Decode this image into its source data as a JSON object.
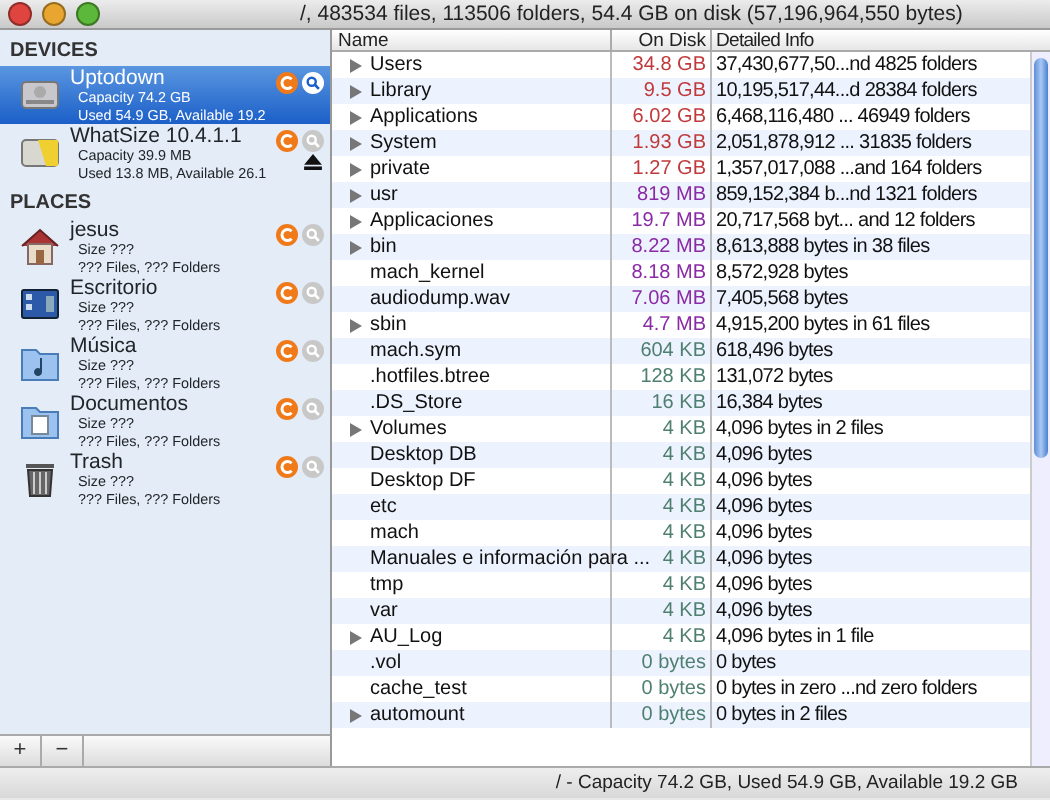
{
  "window": {
    "title": "/, 483534 files, 113506 folders, 54.4 GB on disk (57,196,964,550 bytes)"
  },
  "sidebar": {
    "sections": [
      {
        "heading": "DEVICES",
        "items": [
          {
            "kind": "drive",
            "title": "Uptodown",
            "line_1": "Capacity 74.2 GB",
            "line_2": "Used 54.9 GB, Available 19.2",
            "selected": true,
            "ejectable": false
          },
          {
            "kind": "usb-drive",
            "title": "WhatSize 10.4.1.1",
            "line_1": "Capacity 39.9 MB",
            "line_2": "Used 13.8 MB, Available 26.1",
            "selected": false,
            "ejectable": true
          }
        ]
      },
      {
        "heading": "PLACES",
        "items": [
          {
            "kind": "home",
            "title": "jesus",
            "line_1": "Size ???",
            "line_2": "??? Files, ??? Folders",
            "selected": false,
            "ejectable": false
          },
          {
            "kind": "desktop",
            "title": "Escritorio",
            "line_1": "Size ???",
            "line_2": "??? Files, ??? Folders",
            "selected": false,
            "ejectable": false
          },
          {
            "kind": "music",
            "title": "Música",
            "line_1": "Size ???",
            "line_2": "??? Files, ??? Folders",
            "selected": false,
            "ejectable": false
          },
          {
            "kind": "documents",
            "title": "Documentos",
            "line_1": "Size ???",
            "line_2": "??? Files, ??? Folders",
            "selected": false,
            "ejectable": false
          },
          {
            "kind": "trash",
            "title": "Trash",
            "line_1": "Size ???",
            "line_2": "??? Files, ??? Folders",
            "selected": false,
            "ejectable": false
          }
        ]
      }
    ],
    "buttons": [
      "+",
      "−"
    ]
  },
  "table": {
    "columns": [
      "Name",
      "On Disk",
      "Detailed Info"
    ],
    "rows": [
      {
        "name": "Users",
        "on_disk": "34.8 GB",
        "info": "37,430,677,50...nd 4825 folders",
        "expandable": true,
        "color": "#c0393b"
      },
      {
        "name": "Library",
        "on_disk": "9.5 GB",
        "info": "10,195,517,44...d 28384 folders",
        "expandable": true,
        "color": "#c0393b"
      },
      {
        "name": "Applications",
        "on_disk": "6.02 GB",
        "info": "6,468,116,480 ... 46949 folders",
        "expandable": true,
        "color": "#c0393b"
      },
      {
        "name": "System",
        "on_disk": "1.93 GB",
        "info": "2,051,878,912 ... 31835 folders",
        "expandable": true,
        "color": "#c0393b"
      },
      {
        "name": "private",
        "on_disk": "1.27 GB",
        "info": "1,357,017,088 ...and 164 folders",
        "expandable": true,
        "color": "#c0393b"
      },
      {
        "name": "usr",
        "on_disk": "819 MB",
        "info": "859,152,384 b...nd 1321 folders",
        "expandable": true,
        "color": "#8a2aa5"
      },
      {
        "name": "Applicaciones",
        "on_disk": "19.7 MB",
        "info": "20,717,568 byt... and 12 folders",
        "expandable": true,
        "color": "#8a2aa5"
      },
      {
        "name": "bin",
        "on_disk": "8.22 MB",
        "info": "8,613,888 bytes in 38 files",
        "expandable": true,
        "color": "#8a2aa5"
      },
      {
        "name": "mach_kernel",
        "on_disk": "8.18 MB",
        "info": "8,572,928 bytes",
        "expandable": false,
        "color": "#8a2aa5"
      },
      {
        "name": "audiodump.wav",
        "on_disk": "7.06 MB",
        "info": "7,405,568 bytes",
        "expandable": false,
        "color": "#8a2aa5"
      },
      {
        "name": "sbin",
        "on_disk": "4.7 MB",
        "info": "4,915,200 bytes in 61 files",
        "expandable": true,
        "color": "#8a2aa5"
      },
      {
        "name": "mach.sym",
        "on_disk": "604 KB",
        "info": "618,496 bytes",
        "expandable": false,
        "color": "#4f7f70"
      },
      {
        "name": ".hotfiles.btree",
        "on_disk": "128 KB",
        "info": "131,072 bytes",
        "expandable": false,
        "color": "#4f7f70"
      },
      {
        "name": ".DS_Store",
        "on_disk": "16 KB",
        "info": "16,384 bytes",
        "expandable": false,
        "color": "#4f7f70"
      },
      {
        "name": "Volumes",
        "on_disk": "4 KB",
        "info": "4,096 bytes in 2 files",
        "expandable": true,
        "color": "#4f7f70"
      },
      {
        "name": "Desktop DB",
        "on_disk": "4 KB",
        "info": "4,096 bytes",
        "expandable": false,
        "color": "#4f7f70"
      },
      {
        "name": "Desktop DF",
        "on_disk": "4 KB",
        "info": "4,096 bytes",
        "expandable": false,
        "color": "#4f7f70"
      },
      {
        "name": "etc",
        "on_disk": "4 KB",
        "info": "4,096 bytes",
        "expandable": false,
        "color": "#4f7f70"
      },
      {
        "name": "mach",
        "on_disk": "4 KB",
        "info": "4,096 bytes",
        "expandable": false,
        "color": "#4f7f70"
      },
      {
        "name": "Manuales e información para ...",
        "on_disk": "4 KB",
        "info": "4,096 bytes",
        "expandable": false,
        "color": "#4f7f70"
      },
      {
        "name": "tmp",
        "on_disk": "4 KB",
        "info": "4,096 bytes",
        "expandable": false,
        "color": "#4f7f70"
      },
      {
        "name": "var",
        "on_disk": "4 KB",
        "info": "4,096 bytes",
        "expandable": false,
        "color": "#4f7f70"
      },
      {
        "name": "AU_Log",
        "on_disk": "4 KB",
        "info": "4,096 bytes in 1 file",
        "expandable": true,
        "color": "#4f7f70"
      },
      {
        "name": ".vol",
        "on_disk": "0 bytes",
        "info": "0 bytes",
        "expandable": false,
        "color": "#4f7f70"
      },
      {
        "name": "cache_test",
        "on_disk": "0 bytes",
        "info": "0 bytes in zero ...nd zero folders",
        "expandable": false,
        "color": "#4f7f70"
      },
      {
        "name": "automount",
        "on_disk": "0 bytes",
        "info": "0 bytes in 2 files",
        "expandable": true,
        "color": "#4f7f70"
      }
    ]
  },
  "status_bar": "/ - Capacity 74.2 GB, Used 54.9 GB, Available 19.2 GB"
}
